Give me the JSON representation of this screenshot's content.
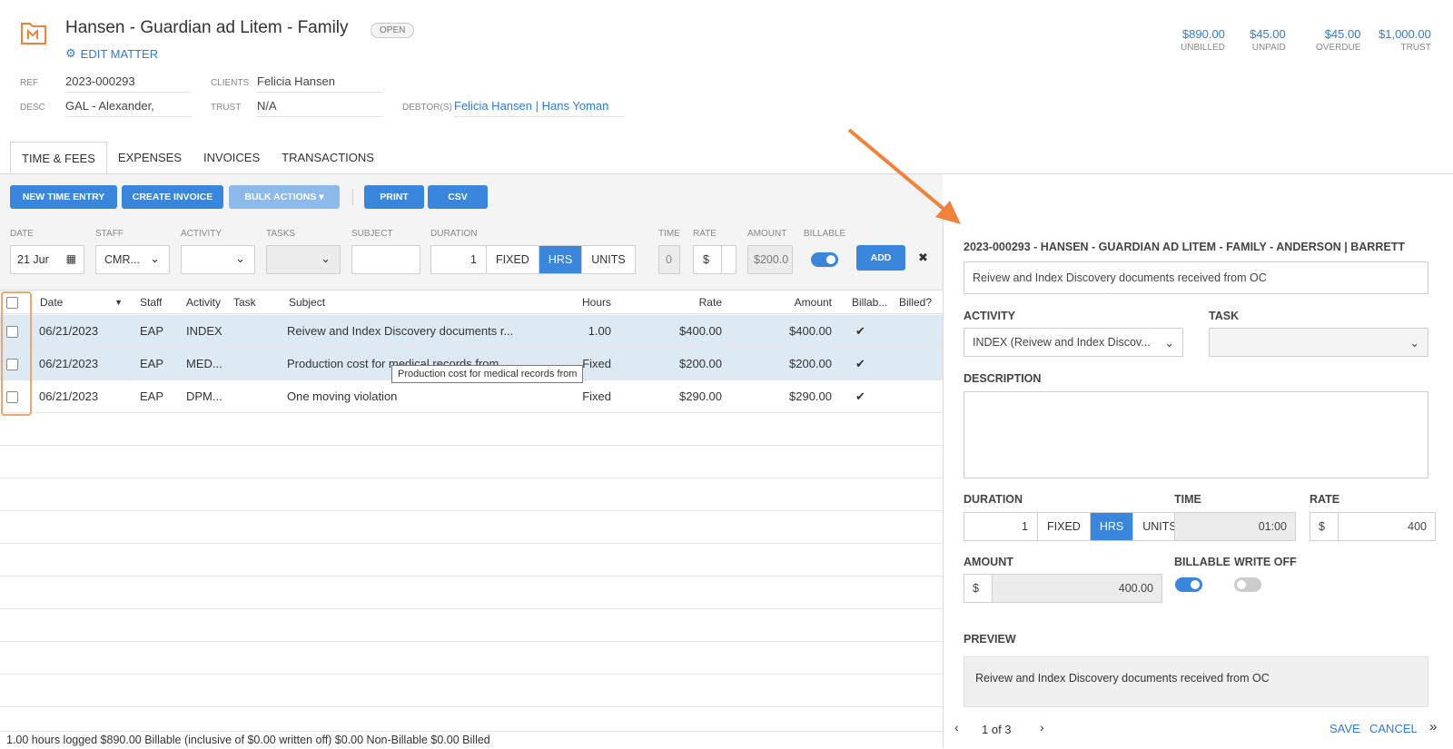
{
  "matter": {
    "title": "Hansen - Guardian ad Litem - Family",
    "status": "OPEN",
    "edit_label": "EDIT MATTER",
    "ref_label": "REF",
    "ref": "2023-000293",
    "desc_label": "DESC",
    "desc": "GAL - Alexander,",
    "clients_label": "CLIENTS",
    "client": "Felicia Hansen",
    "trust_label": "TRUST",
    "trust": "N/A",
    "debtors_label": "DEBTOR(S)",
    "debtor1": "Felicia Hansen",
    "debtor_sep": "|",
    "debtor2": "Hans Yoman"
  },
  "totals": [
    {
      "amount": "$890.00",
      "label": "UNBILLED"
    },
    {
      "amount": "$45.00",
      "label": "UNPAID"
    },
    {
      "amount": "$45.00",
      "label": "OVERDUE"
    },
    {
      "amount": "$1,000.00",
      "label": "TRUST"
    }
  ],
  "tabs": [
    "TIME & FEES",
    "EXPENSES",
    "INVOICES",
    "TRANSACTIONS"
  ],
  "toolbar": {
    "new_time": "NEW TIME ENTRY",
    "create_invoice": "CREATE INVOICE",
    "bulk": "BULK ACTIONS",
    "print": "PRINT",
    "csv": "CSV"
  },
  "filters": {
    "date_label": "DATE",
    "date": "21 Jur",
    "staff_label": "STAFF",
    "staff": "CMR...",
    "activity_label": "ACTIVITY",
    "tasks_label": "TASKS",
    "subject_label": "SUBJECT",
    "duration_label": "DURATION",
    "duration": "1",
    "fixed": "FIXED",
    "hrs": "HRS",
    "units": "UNITS",
    "time_label": "TIME",
    "time": "0",
    "rate_label": "RATE",
    "rate_sym": "$",
    "amount_label": "AMOUNT",
    "amount": "$200.0",
    "billable_label": "BILLABLE",
    "add": "ADD",
    "clear": "✖"
  },
  "grid": {
    "headers": {
      "date": "Date",
      "staff": "Staff",
      "activity": "Activity",
      "task": "Task",
      "subject": "Subject",
      "hours": "Hours",
      "rate": "Rate",
      "amount": "Amount",
      "billable": "Billab...",
      "billed": "Billed?"
    },
    "rows": [
      {
        "date": "06/21/2023",
        "staff": "EAP",
        "activity": "INDEX",
        "task": "",
        "subject": "Reivew and Index Discovery documents r...",
        "hours": "1.00",
        "rate": "$400.00",
        "amount": "$400.00",
        "billable": "✔",
        "billed": ""
      },
      {
        "date": "06/21/2023",
        "staff": "EAP",
        "activity": "MED...",
        "task": "",
        "subject": "Production cost for medical records from",
        "hours": "Fixed",
        "rate": "$200.00",
        "amount": "$200.00",
        "billable": "✔",
        "billed": ""
      },
      {
        "date": "06/21/2023",
        "staff": "EAP",
        "activity": "DPM...",
        "task": "",
        "subject": "One moving violation",
        "hours": "Fixed",
        "rate": "$290.00",
        "amount": "$290.00",
        "billable": "✔",
        "billed": ""
      }
    ],
    "tooltip": "Production cost for medical records from"
  },
  "footer": "1.00 hours logged  $890.00 Billable (inclusive of $0.00 written off)  $0.00 Non-Billable  $0.00 Billed",
  "panel": {
    "heading": "2023-000293 - HANSEN - GUARDIAN AD LITEM - FAMILY - ANDERSON | BARRETT",
    "subject": "Reivew and Index Discovery documents received from OC",
    "activity_label": "ACTIVITY",
    "activity": "INDEX (Reivew and Index Discov...",
    "task_label": "TASK",
    "description_label": "DESCRIPTION",
    "duration_label": "DURATION",
    "duration": "1",
    "fixed": "FIXED",
    "hrs": "HRS",
    "units": "UNITS",
    "time_label": "TIME",
    "time": "01:00",
    "rate_label": "RATE",
    "rate_sym": "$",
    "rate": "400",
    "amount_label": "AMOUNT",
    "amount_sym": "$",
    "amount": "400.00",
    "billable_label": "BILLABLE",
    "writeoff_label": "WRITE OFF",
    "preview_label": "PREVIEW",
    "preview": "Reivew and Index Discovery documents received from OC",
    "pager": "1 of 3",
    "save": "SAVE",
    "cancel": "CANCEL"
  },
  "colors": {
    "accent": "#3a86dc",
    "arrow": "#f0823a",
    "highlight_row": "#dde9f3"
  }
}
